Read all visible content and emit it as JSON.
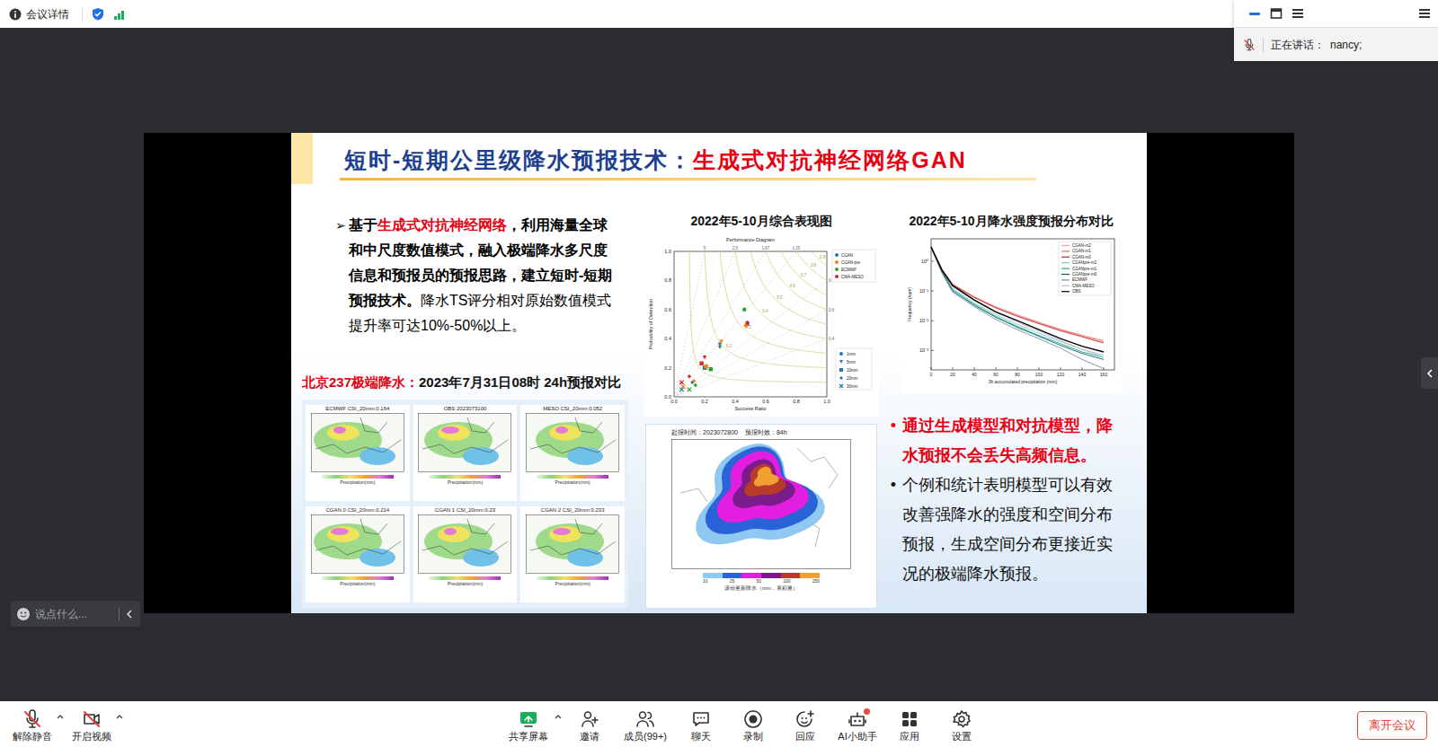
{
  "top_bar": {
    "info_label": "会议详情"
  },
  "speaker_panel": {
    "label": "正在讲话：",
    "name": "nancy;",
    "mic_muted": true
  },
  "chat_input": {
    "placeholder": "说点什么..."
  },
  "slide": {
    "title_blue": "短时-短期公里级降水预报技术：",
    "title_red": "生成式对抗神经网络GAN",
    "bullet_marker": "➢",
    "intro": [
      {
        "text": "基于",
        "color": "#000000",
        "bold": true
      },
      {
        "text": "生成式对抗神经网络",
        "color": "#e60012",
        "bold": true
      },
      {
        "text": "，利用海量全球和中尺度数值模式，融入极端降水多尺度信息和预报员的预报思路，建立短时-短期预报技术。",
        "color": "#000000",
        "bold": true
      },
      {
        "text": "降水TS评分相对原始数值模式 提升率可达10%-50%以上。",
        "color": "#000000",
        "bold": false
      }
    ],
    "case_title_red": "北京237极端降水：",
    "case_title": "2023年7月31日08时 24h预报对比",
    "maps": [
      {
        "title": "ECMWF CSI_20mm:0.164",
        "label": "Precipitation(mm)"
      },
      {
        "title": "OBS 2023073100",
        "label": "Precipitation(mm)"
      },
      {
        "title": "MESO CSI_20mm:0.052",
        "label": "Precipitation(mm)"
      },
      {
        "title": "CGAN 0 CSI_20mm:0.214",
        "label": "Precipitation(mm)"
      },
      {
        "title": "CGAN 1 CSI_20mm:0.23",
        "label": "Precipitation(mm)"
      },
      {
        "title": "CGAN 2 CSI_20mm:0.233",
        "label": "Precipitation(mm)"
      }
    ],
    "perf": {
      "heading": "2022年5-10月综合表现图",
      "title": "Performance Diagram",
      "x_label": "Success Ratio",
      "y_label": "Probability of Detection",
      "ticks": [
        "0.0",
        "0.2",
        "0.4",
        "0.6",
        "0.8",
        "1.0"
      ],
      "csi_levels": [
        "0.1",
        "0.2",
        "0.3",
        "0.4",
        "0.5",
        "0.6",
        "0.7",
        "0.8",
        "0.9"
      ],
      "bias_levels": [
        "5",
        "2.5",
        "1.67",
        "1.25",
        "0.8",
        "0.6",
        "0.4"
      ],
      "thresholds": [
        {
          "label": "1mm",
          "kind": "circle"
        },
        {
          "label": "5mm",
          "kind": "triangle"
        },
        {
          "label": "10mm",
          "kind": "square"
        },
        {
          "label": "20mm",
          "kind": "diamond"
        },
        {
          "label": "30mm",
          "kind": "cross"
        }
      ],
      "models": [
        {
          "label": "CGAN",
          "color": "#1f77b4",
          "sr": [
            0.48,
            0.3,
            0.2,
            0.12,
            0.05
          ],
          "pod": [
            0.5,
            0.36,
            0.2,
            0.1,
            0.05
          ]
        },
        {
          "label": "CGAN-pre",
          "color": "#ff7f0e",
          "sr": [
            0.47,
            0.31,
            0.21,
            0.13,
            0.06
          ],
          "pod": [
            0.49,
            0.38,
            0.21,
            0.11,
            0.07
          ]
        },
        {
          "label": "ECMWF",
          "color": "#2ca02c",
          "sr": [
            0.46,
            0.3,
            0.24,
            0.14,
            0.1
          ],
          "pod": [
            0.6,
            0.34,
            0.19,
            0.08,
            0.05
          ]
        },
        {
          "label": "CMA-MESO",
          "color": "#d62728",
          "sr": [
            0.48,
            0.2,
            0.18,
            0.1,
            0.05
          ],
          "pod": [
            0.51,
            0.27,
            0.23,
            0.14,
            0.1
          ]
        }
      ]
    },
    "dist": {
      "heading": "2022年5-10月降水强度预报分布对比",
      "x_label": "3h accumulated precipitation (mm)",
      "y_label": "Frequency (num)",
      "x_ticks": [
        "0",
        "20",
        "40",
        "60",
        "80",
        "100",
        "120",
        "140",
        "160"
      ],
      "y_ticks": [
        {
          "label": "10⁰",
          "exp": 0
        },
        {
          "label": "10⁻¹",
          "exp": -1
        },
        {
          "label": "10⁻²",
          "exp": -2
        },
        {
          "label": "10⁻³",
          "exp": -3
        }
      ],
      "x": [
        0,
        10,
        20,
        40,
        60,
        80,
        100,
        120,
        140,
        160
      ],
      "series": [
        {
          "label": "CGAN-m2",
          "color": "#f4a6a6",
          "values": [
            3,
            0.55,
            0.17,
            0.065,
            0.03,
            0.016,
            0.009,
            0.0052,
            0.0033,
            0.0022
          ]
        },
        {
          "label": "CGAN-m1",
          "color": "#e57373",
          "values": [
            3,
            0.54,
            0.165,
            0.062,
            0.028,
            0.015,
            0.0085,
            0.005,
            0.0031,
            0.002
          ]
        },
        {
          "label": "CGAN-m0",
          "color": "#c62828",
          "values": [
            3,
            0.53,
            0.16,
            0.06,
            0.027,
            0.014,
            0.008,
            0.0046,
            0.0029,
            0.0018
          ]
        },
        {
          "label": "CGANpre-m2",
          "color": "#80cbc4",
          "values": [
            3,
            0.45,
            0.12,
            0.04,
            0.016,
            0.0075,
            0.0038,
            0.002,
            0.0011,
            0.0007
          ]
        },
        {
          "label": "CGANpre-m1",
          "color": "#26a69a",
          "values": [
            3,
            0.44,
            0.11,
            0.036,
            0.014,
            0.0065,
            0.0032,
            0.0017,
            0.0009,
            0.0006
          ]
        },
        {
          "label": "CGANpre-m0",
          "color": "#00695c",
          "values": [
            3,
            0.43,
            0.1,
            0.033,
            0.013,
            0.006,
            0.003,
            0.0015,
            0.0008,
            0.0005
          ]
        },
        {
          "label": "ECMWF",
          "color": "#7f8fa6",
          "values": [
            3,
            0.4,
            0.09,
            0.03,
            0.011,
            0.005,
            0.0025,
            0.0012,
            0.0005,
            0.00025
          ]
        },
        {
          "label": "CMA-MESO",
          "color": "#c5b3d6",
          "values": [
            3,
            0.5,
            0.14,
            0.048,
            0.019,
            0.009,
            0.0045,
            0.0022,
            0.0011,
            0.0006
          ]
        },
        {
          "label": "OBS",
          "color": "#000000",
          "values": [
            3,
            0.5,
            0.15,
            0.05,
            0.02,
            0.01,
            0.005,
            0.0025,
            0.0014,
            0.0009
          ]
        }
      ]
    },
    "forecast": {
      "init": "起报时间：2023072800",
      "lead": "预报时效：84h",
      "ticks": [
        "10",
        "25",
        "50",
        "100",
        "250"
      ],
      "caption": "滚动更新降水（mm，累积量）"
    },
    "points": [
      {
        "marker": "•",
        "text": "通过生成模型和对抗模型，降水预报不会丢失高频信息。",
        "color": "#e60012",
        "bold": true
      },
      {
        "marker": "•",
        "text": "个例和统计表明模型可以有效改善强降水的强度和空间分布预报，生成空间分布更接近实况的极端降水预报。",
        "color": "#111111",
        "bold": false
      }
    ]
  },
  "toolbar": {
    "left": [
      {
        "label": "解除静音",
        "kind": "mic",
        "off": true,
        "has_menu": true
      },
      {
        "label": "开启视频",
        "kind": "camera",
        "off": true,
        "has_menu": true
      }
    ],
    "center": [
      {
        "label": "共享屏幕",
        "kind": "share",
        "badge": false,
        "has_menu": true
      },
      {
        "label": "邀请",
        "kind": "invite",
        "badge": false,
        "has_menu": false
      },
      {
        "label": "成员(99+)",
        "kind": "members",
        "badge": false,
        "has_menu": false
      },
      {
        "label": "聊天",
        "kind": "chat",
        "badge": false,
        "has_menu": false
      },
      {
        "label": "录制",
        "kind": "record",
        "badge": false,
        "has_menu": false
      },
      {
        "label": "回应",
        "kind": "react",
        "badge": false,
        "has_menu": false
      },
      {
        "label": "AI小助手",
        "kind": "ai",
        "badge": true,
        "has_menu": false
      },
      {
        "label": "应用",
        "kind": "apps",
        "badge": false,
        "has_menu": false
      },
      {
        "label": "设置",
        "kind": "settings",
        "badge": false,
        "has_menu": false
      }
    ],
    "leave": "离开会议"
  }
}
